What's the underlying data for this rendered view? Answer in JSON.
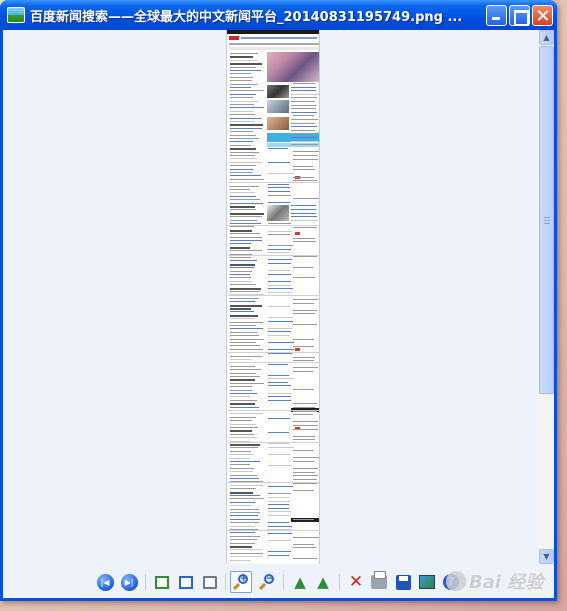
{
  "window": {
    "title": "百度新闻搜索——全球最大的中文新闻平台_20140831195749.png ..."
  },
  "titlebar_buttons": {
    "minimize": "minimize",
    "maximize": "maximize",
    "close": "close"
  },
  "toolbar": {
    "items": [
      {
        "icon": "previous-image-icon",
        "glyph": "|◀"
      },
      {
        "icon": "next-image-icon",
        "glyph": "▶|"
      },
      {
        "icon": "best-fit-icon"
      },
      {
        "icon": "actual-size-icon"
      },
      {
        "icon": "slideshow-icon"
      },
      {
        "icon": "zoom-in-icon",
        "glyph": "+",
        "pressed": true
      },
      {
        "icon": "zoom-out-icon",
        "glyph": "−"
      },
      {
        "icon": "rotate-clockwise-icon"
      },
      {
        "icon": "rotate-counterclockwise-icon"
      },
      {
        "icon": "delete-icon",
        "glyph": "✕"
      },
      {
        "icon": "print-icon"
      },
      {
        "icon": "save-icon"
      },
      {
        "icon": "edit-icon"
      },
      {
        "icon": "help-icon",
        "glyph": "?"
      }
    ]
  },
  "watermark": {
    "text": "Bai 经验"
  },
  "colors": {
    "title_bar": "#0050e0",
    "client_bg": "#eef2fb",
    "close_button": "#d6421e",
    "document_banner": "#3fb1e1"
  }
}
